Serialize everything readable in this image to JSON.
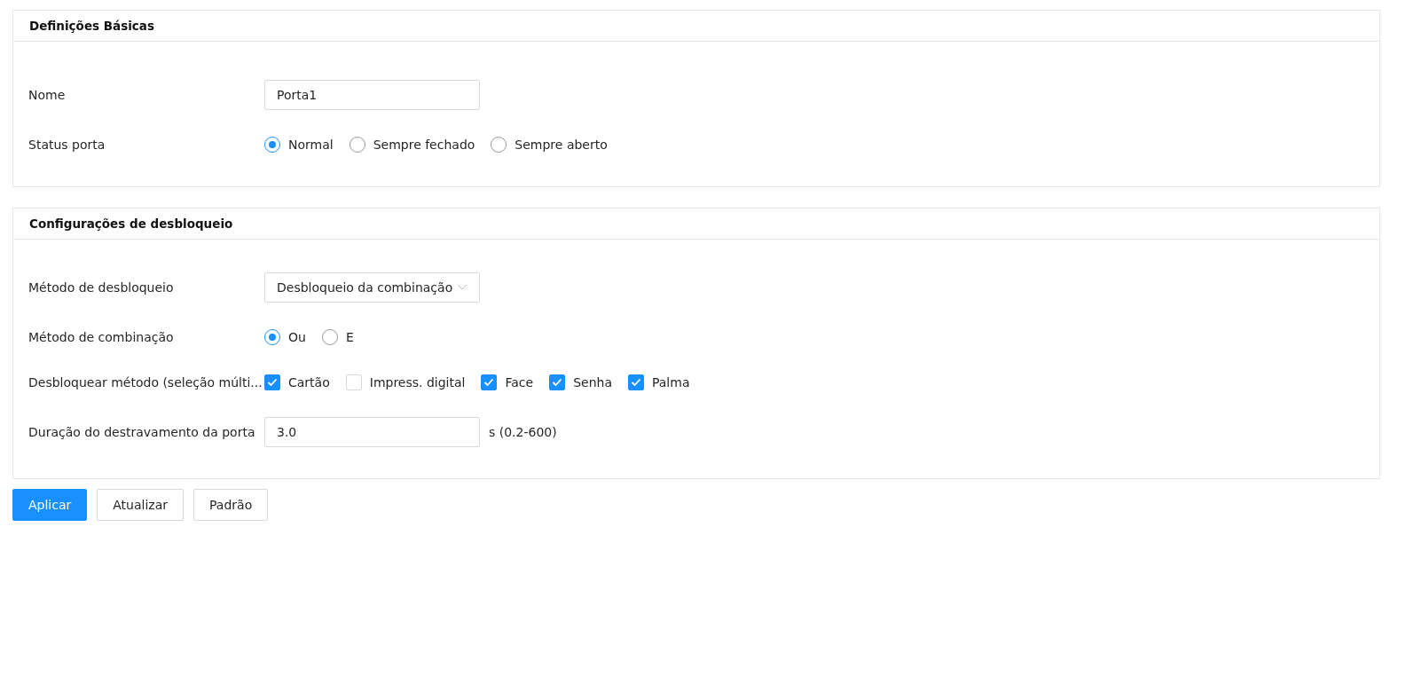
{
  "sections": [
    {
      "title": "Definições Básicas",
      "rows": [
        {
          "kind": "input",
          "label": "Nome",
          "value": "Porta1"
        },
        {
          "kind": "radio",
          "label": "Status porta",
          "options": [
            {
              "label": "Normal",
              "selected": true
            },
            {
              "label": "Sempre fechado",
              "selected": false
            },
            {
              "label": "Sempre aberto",
              "selected": false
            }
          ]
        }
      ]
    },
    {
      "title": "Configurações de desbloqueio",
      "rows": [
        {
          "kind": "select",
          "label": "Método de desbloqueio",
          "value": "Desbloqueio da combinação"
        },
        {
          "kind": "radio",
          "label": "Método de combinação",
          "options": [
            {
              "label": "Ou",
              "selected": true
            },
            {
              "label": "E",
              "selected": false
            }
          ]
        },
        {
          "kind": "checkbox",
          "label": "Desbloquear método (seleção múlti...",
          "options": [
            {
              "label": "Cartão",
              "checked": true
            },
            {
              "label": "Impress. digital",
              "checked": false
            },
            {
              "label": "Face",
              "checked": true
            },
            {
              "label": "Senha",
              "checked": true
            },
            {
              "label": "Palma",
              "checked": true
            }
          ]
        },
        {
          "kind": "input",
          "label": "Duração do destravamento da porta",
          "value": "3.0",
          "suffix": "s (0.2-600)"
        }
      ]
    }
  ],
  "buttons": [
    {
      "label": "Aplicar",
      "primary": true
    },
    {
      "label": "Atualizar",
      "primary": false
    },
    {
      "label": "Padrão",
      "primary": false
    }
  ]
}
